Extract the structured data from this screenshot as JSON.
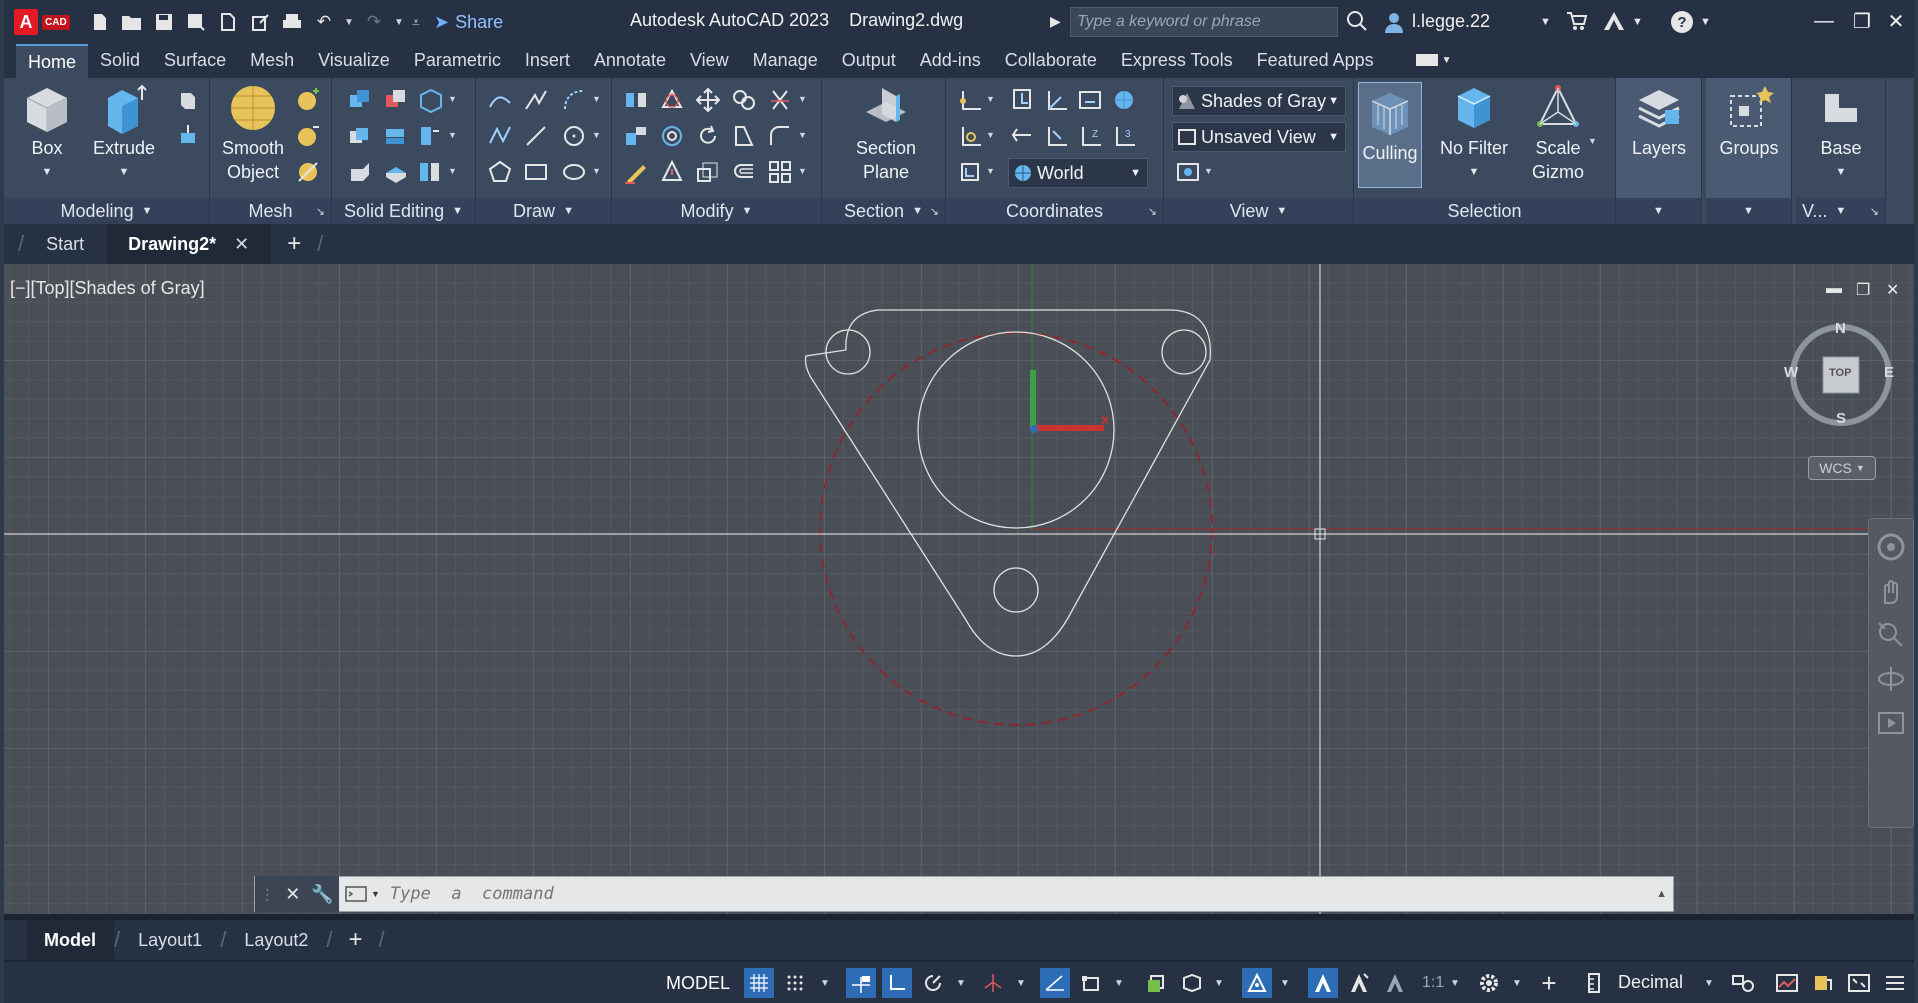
{
  "window": {
    "title_app": "Autodesk AutoCAD 2023",
    "title_file": "Drawing2.dwg",
    "logo_letter": "A",
    "logo_badge": "CAD",
    "share_label": "Share",
    "search_placeholder": "Type a keyword or phrase",
    "user_name": "l.legge.22"
  },
  "ribbon_tabs": [
    "Home",
    "Solid",
    "Surface",
    "Mesh",
    "Visualize",
    "Parametric",
    "Insert",
    "Annotate",
    "View",
    "Manage",
    "Output",
    "Add-ins",
    "Collaborate",
    "Express Tools",
    "Featured Apps"
  ],
  "ribbon": {
    "modeling": {
      "label": "Modeling",
      "box": "Box",
      "extrude": "Extrude"
    },
    "mesh": {
      "label": "Mesh",
      "smooth_object_1": "Smooth",
      "smooth_object_2": "Object"
    },
    "solid_editing": {
      "label": "Solid Editing"
    },
    "draw": {
      "label": "Draw"
    },
    "modify": {
      "label": "Modify"
    },
    "section": {
      "label": "Section",
      "plane_1": "Section",
      "plane_2": "Plane"
    },
    "coordinates": {
      "label": "Coordinates",
      "ucs_combo": "World"
    },
    "view": {
      "label": "View",
      "visual_style": "Shades of Gray",
      "named_view": "Unsaved View"
    },
    "selection": {
      "label": "Selection",
      "culling": "Culling",
      "no_filter": "No Filter",
      "scale_gizmo_1": "Scale",
      "scale_gizmo_2": "Gizmo"
    },
    "layers": {
      "label": "Layers"
    },
    "groups": {
      "label": "Groups"
    },
    "base": {
      "label": "Base",
      "panel_label": "V..."
    }
  },
  "doc_tabs": {
    "start": "Start",
    "active": "Drawing2*"
  },
  "viewport": {
    "label": "[−][Top][Shades of Gray]",
    "compass": {
      "n": "N",
      "s": "S",
      "e": "E",
      "w": "W",
      "top": "TOP"
    },
    "wcs": "WCS"
  },
  "command": {
    "placeholder": "Type  a  command"
  },
  "layout_tabs": [
    "Model",
    "Layout1",
    "Layout2"
  ],
  "status": {
    "model": "MODEL",
    "scale": "1:1",
    "units": "Decimal"
  },
  "colors": {
    "accent": "#2d6db5",
    "ribbon": "#3b4a5f",
    "titlebar": "#263244",
    "canvas": "#4a4f57",
    "construction_circle": "#a01c22"
  }
}
